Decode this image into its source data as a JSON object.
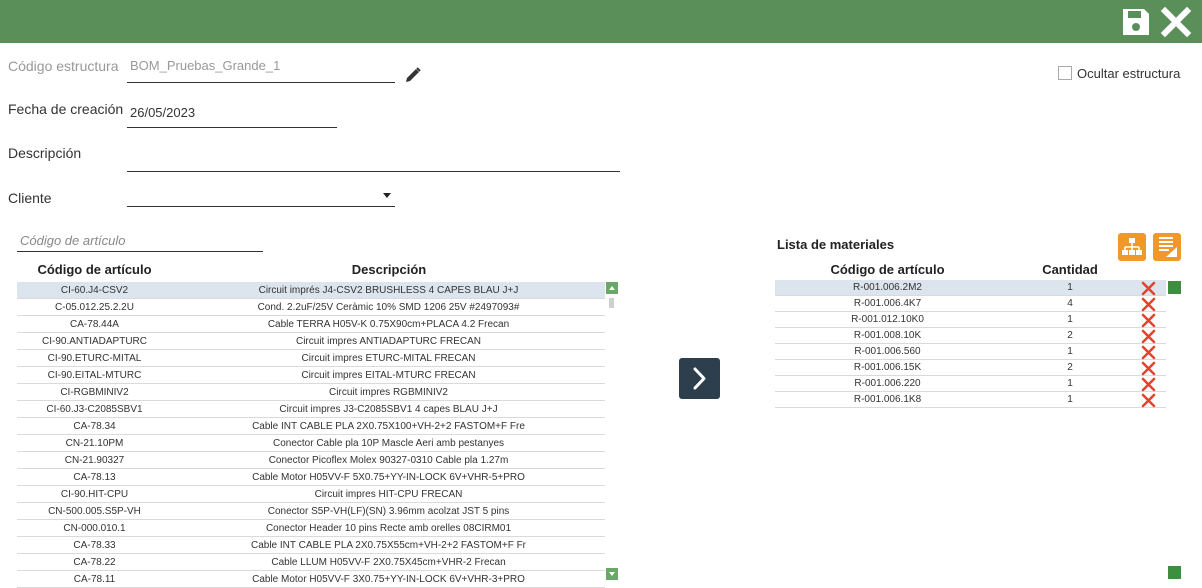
{
  "header": {
    "save_icon": "save-icon",
    "close_icon": "close-icon",
    "bar_color": "#5a8f5a"
  },
  "form": {
    "codigo_label": "Código estructura",
    "codigo_value": "BOM_Pruebas_Grande_1",
    "edit_icon": "pencil-icon",
    "fecha_label": "Fecha de creación",
    "fecha_value": "26/05/2023",
    "descripcion_label": "Descripción",
    "descripcion_value": "",
    "cliente_label": "Cliente",
    "cliente_value": "",
    "ocultar_label": "Ocultar estructura",
    "ocultar_checked": false
  },
  "articles": {
    "search_placeholder": "Código de artículo",
    "columns": [
      "Código de artículo",
      "Descripción"
    ],
    "rows": [
      {
        "code": "CI-60.J4-CSV2",
        "desc": "Circuit imprés J4-CSV2 BRUSHLESS 4 CAPES BLAU J+J",
        "selected": true
      },
      {
        "code": "C-05.012.25.2.2U",
        "desc": "Cond. 2.2uF/25V Ceràmic 10% SMD 1206 25V #2497093#"
      },
      {
        "code": "CA-78.44A",
        "desc": "Cable TERRA H05V-K 0.75X90cm+PLACA 4.2 Frecan"
      },
      {
        "code": "CI-90.ANTIADAPTURC",
        "desc": "Circuit impres ANTIADAPTURC FRECAN"
      },
      {
        "code": "CI-90.ETURC-MITAL",
        "desc": "Circuit impres ETURC-MITAL FRECAN"
      },
      {
        "code": "CI-90.EITAL-MTURC",
        "desc": "Circuit impres EITAL-MTURC FRECAN"
      },
      {
        "code": "CI-RGBMINIV2",
        "desc": "Circuit impres RGBMINIV2"
      },
      {
        "code": "CI-60.J3-C2085SBV1",
        "desc": "Circuit impres J3-C2085SBV1  4 capes BLAU J+J"
      },
      {
        "code": "CA-78.34",
        "desc": "Cable INT CABLE PLA 2X0.75X100+VH-2+2 FASTOM+F Fre"
      },
      {
        "code": "CN-21.10PM",
        "desc": "Conector Cable pla 10P Mascle Aeri amb pestanyes"
      },
      {
        "code": "CN-21.90327",
        "desc": "Conector Picoflex Molex 90327-0310 Cable pla 1.27m"
      },
      {
        "code": "CA-78.13",
        "desc": "Cable Motor H05VV-F 5X0.75+YY-IN-LOCK 6V+VHR-5+PRO"
      },
      {
        "code": "CI-90.HIT-CPU",
        "desc": "Circuit impres HIT-CPU FRECAN"
      },
      {
        "code": "CN-500.005.S5P-VH",
        "desc": "Conector S5P-VH(LF)(SN) 3.96mm acolzat JST 5 pins"
      },
      {
        "code": "CN-000.010.1",
        "desc": "Conector Header 10 pins Recte amb orelles 08CIRM01"
      },
      {
        "code": "CA-78.33",
        "desc": "Cable INT CABLE PLA 2X0.75X55cm+VH-2+2 FASTOM+F Fr"
      },
      {
        "code": "CA-78.22",
        "desc": "Cable LLUM H05VV-F 2X0.75X45cm+VHR-2 Frecan"
      },
      {
        "code": "CA-78.11",
        "desc": "Cable Motor H05VV-F 3X0.75+YY-IN-LOCK 6V+VHR-3+PRO"
      }
    ]
  },
  "materials": {
    "title": "Lista de materiales",
    "columns": [
      "Código de artículo",
      "Cantidad"
    ],
    "rows": [
      {
        "code": "R-001.006.2M2",
        "qty": "1",
        "selected": true
      },
      {
        "code": "R-001.006.4K7",
        "qty": "4"
      },
      {
        "code": "R-001.012.10K0",
        "qty": "1"
      },
      {
        "code": "R-001.008.10K",
        "qty": "2"
      },
      {
        "code": "R-001.006.560",
        "qty": "1"
      },
      {
        "code": "R-001.006.15K",
        "qty": "2"
      },
      {
        "code": "R-001.006.220",
        "qty": "1"
      },
      {
        "code": "R-001.006.1K8",
        "qty": "1"
      }
    ],
    "tree_icon": "hierarchy-icon",
    "list_icon": "list-edit-icon",
    "delete_icon": "delete-x-icon"
  },
  "colors": {
    "accent_green": "#5a8f5a",
    "delete_red": "#e0442c",
    "orange": "#f0982a",
    "selected_row": "#dce4ee",
    "arrow_button": "#2d3e4c"
  }
}
